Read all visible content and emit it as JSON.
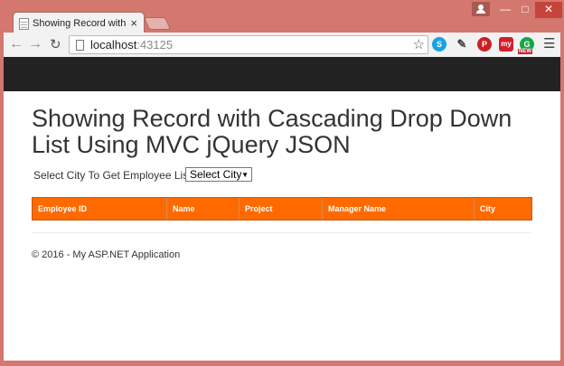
{
  "browser": {
    "tab_title": "Showing Record with Cas",
    "tab_close": "×",
    "url_host": "localhost",
    "url_port": ":43125",
    "icons": [
      "back-icon",
      "forward-icon",
      "reload-icon",
      "bookmark-star-icon",
      "skype-icon",
      "eyedropper-icon",
      "pinterest-icon",
      "my-icon",
      "grammarly-icon",
      "menu-icon"
    ],
    "ext_my_label": "my",
    "ext_grammarly_badge": "NEW"
  },
  "page": {
    "heading": "Showing Record with Cascading Drop Down List Using MVC jQuery JSON",
    "filter_label": "Select City To Get Employee List :",
    "select_value": "Select City",
    "table": {
      "headers": [
        "Employee ID",
        "Name",
        "Project",
        "Manager Name",
        "City"
      ],
      "header_color": "#ff6a00"
    },
    "footer": "© 2016 - My ASP.NET Application"
  },
  "colors": {
    "frame": "#d4776f",
    "navbar": "#222222",
    "close_button": "#c7443b"
  }
}
